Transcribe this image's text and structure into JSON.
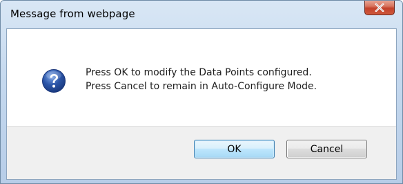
{
  "window": {
    "title": "Message from webpage",
    "close_glyph": "X"
  },
  "dialog": {
    "icon": "question-icon",
    "icon_color": "#2b55a8",
    "message_line1": "Press OK to modify the Data Points configured.",
    "message_line2": "Press Cancel to remain in Auto-Configure Mode."
  },
  "buttons": {
    "ok_label": "OK",
    "cancel_label": "Cancel"
  },
  "colors": {
    "close_button": "#c94a32",
    "default_button_border": "#3c7fb1"
  }
}
